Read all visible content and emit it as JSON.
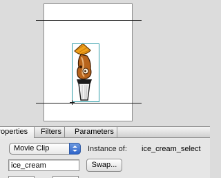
{
  "panel": {
    "tabs": [
      {
        "label": "Properties"
      },
      {
        "label": "Filters"
      },
      {
        "label": "Parameters"
      }
    ],
    "symbol_type": "Movie Clip",
    "instance_of_label": "Instance of:",
    "instance_of_value": "ice_cream_select",
    "instance_name": "ice_cream",
    "swap_label": "Swap..."
  },
  "colors": {
    "bbox": "#2a9aa6",
    "select_arrow": "#3a6fd0",
    "cone": "#f0a11a",
    "cup": "#f2f2f2"
  }
}
